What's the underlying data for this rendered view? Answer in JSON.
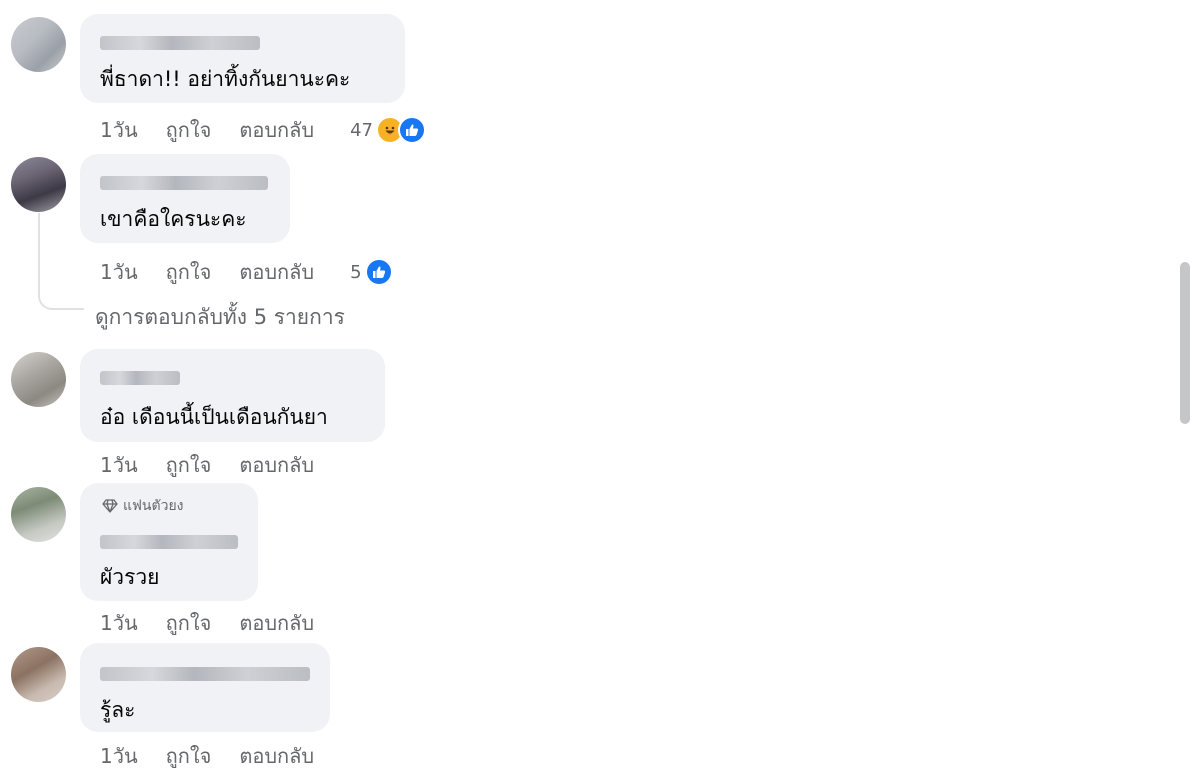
{
  "comments": [
    {
      "text": "พี่ธาดา!! อย่าทิ้งกันยานะคะ",
      "time": "1วัน",
      "like_label": "ถูกใจ",
      "reply_label": "ตอบกลับ",
      "reaction_count": "47",
      "reactions": [
        "haha-icon",
        "like-icon"
      ]
    },
    {
      "text": "เขาคือใครนะคะ",
      "time": "1วัน",
      "like_label": "ถูกใจ",
      "reply_label": "ตอบกลับ",
      "reaction_count": "5",
      "reactions": [
        "like-icon"
      ],
      "view_replies": "ดูการตอบกลับทั้ง 5 รายการ"
    },
    {
      "text": "อ๋อ เดือนนี้เป็นเดือนกันยา",
      "time": "1วัน",
      "like_label": "ถูกใจ",
      "reply_label": "ตอบกลับ"
    },
    {
      "badge": "แฟนตัวยง",
      "text": "ผัวรวย",
      "time": "1วัน",
      "like_label": "ถูกใจ",
      "reply_label": "ตอบกลับ"
    },
    {
      "text": "รู้ละ",
      "time": "1วัน",
      "like_label": "ถูกใจ",
      "reply_label": "ตอบกลับ"
    }
  ],
  "colors": {
    "bubble": "#f0f2f5",
    "meta_text": "#65676b",
    "like_blue": "#1877f2",
    "haha_yellow": "#f7b125"
  }
}
